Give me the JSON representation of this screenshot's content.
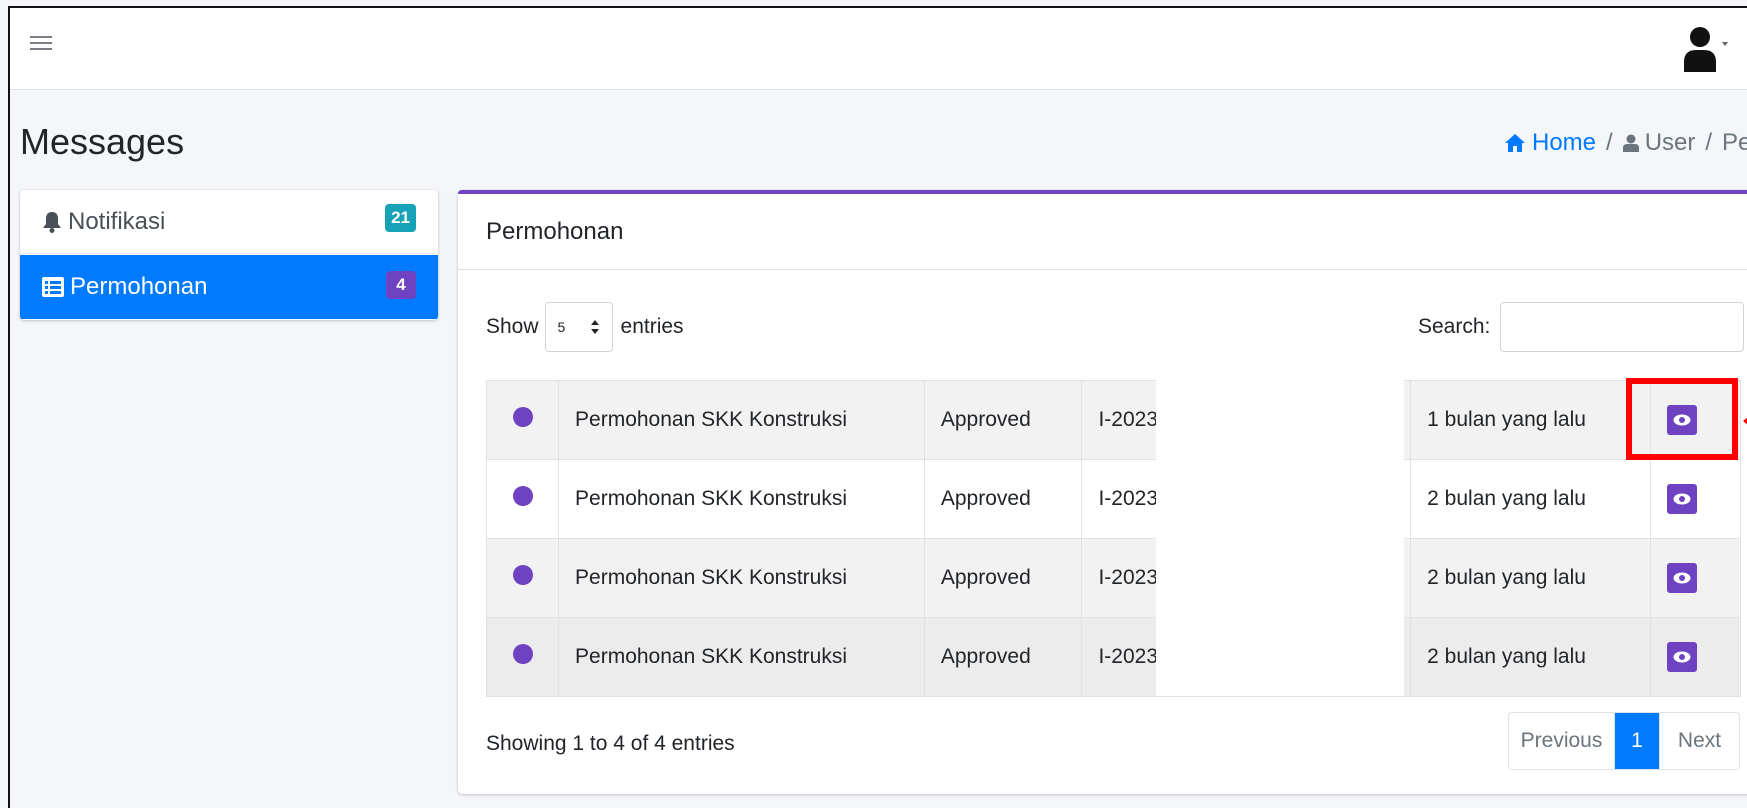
{
  "page": {
    "title": "Messages"
  },
  "breadcrumb": {
    "home": "Home",
    "sep1": "/",
    "user": "User",
    "sep2": "/",
    "current": "Pesan"
  },
  "sidebar": {
    "items": [
      {
        "label": "Notifikasi",
        "badge": "21",
        "icon": "bell-icon",
        "badge_color": "#17a2b8"
      },
      {
        "label": "Permohonan",
        "badge": "4",
        "icon": "list-icon",
        "badge_color": "#6f42c1",
        "active": true
      }
    ]
  },
  "card": {
    "title": "Permohonan",
    "accent_color": "#6f42c1"
  },
  "length_control": {
    "before": "Show",
    "value": "5",
    "after": "entries"
  },
  "search": {
    "label": "Search:",
    "value": ""
  },
  "table": {
    "rows": [
      {
        "title": "Permohonan SKK Konstruksi",
        "status": "Approved",
        "ref": "I-2023",
        "time": "1 bulan yang lalu"
      },
      {
        "title": "Permohonan SKK Konstruksi",
        "status": "Approved",
        "ref": "I-2023",
        "time": "2 bulan yang lalu"
      },
      {
        "title": "Permohonan SKK Konstruksi",
        "status": "Approved",
        "ref": "I-2023",
        "time": "2 bulan yang lalu"
      },
      {
        "title": "Permohonan SKK Konstruksi",
        "status": "Approved",
        "ref": "I-2023",
        "time": "2 bulan yang lalu"
      }
    ]
  },
  "footer": {
    "info": "Showing 1 to 4 of 4 entries",
    "pagination": {
      "previous": "Previous",
      "current": "1",
      "next": "Next"
    }
  },
  "colors": {
    "primary": "#007bff",
    "purple": "#6f42c1",
    "teal": "#17a2b8",
    "annotation": "#ff0000"
  }
}
